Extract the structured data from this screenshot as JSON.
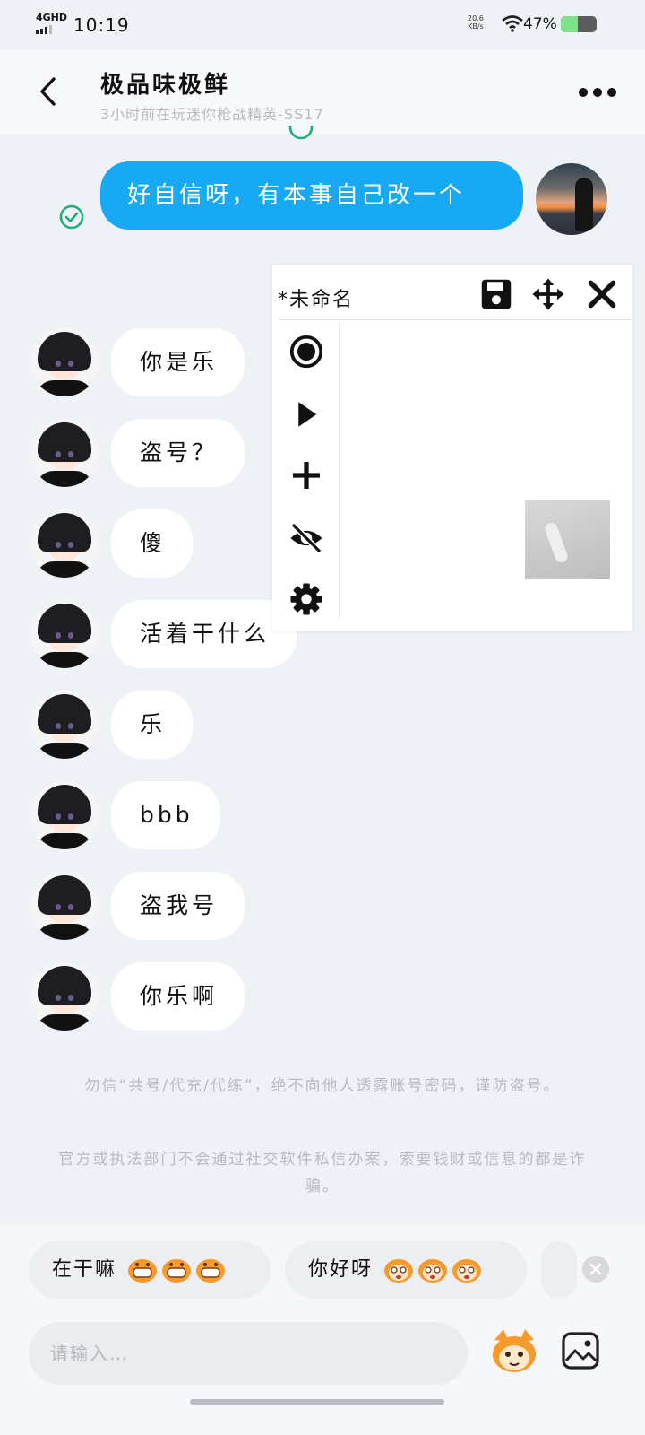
{
  "status_bar": {
    "network": "4GHD",
    "time": "10:19",
    "net_speed_value": "20.6",
    "net_speed_unit": "KB/s",
    "battery_percent": "47%",
    "battery_level": 0.47
  },
  "header": {
    "title": "极品味极鲜",
    "subtitle": "3小时前在玩迷你枪战精英-SS17"
  },
  "messages": {
    "sent": "好自信呀，有本事自己改一个",
    "received": [
      "你是乐",
      "盗号？",
      "傻",
      "活着干什么",
      "乐",
      "bbb",
      "盗我号",
      "你乐啊"
    ]
  },
  "notices": [
    "勿信“共号/代充/代练”，绝不向他人透露账号密码，谨防盗号。",
    "官方或执法部门不会通过社交软件私信办案，索要钱财或信息的都是诈骗。"
  ],
  "tool_panel": {
    "title": "*未命名",
    "icons": [
      "save-icon",
      "move-icon",
      "close-icon",
      "record-icon",
      "play-icon",
      "add-icon",
      "hide-icon",
      "settings-icon"
    ]
  },
  "quick_replies": [
    {
      "label": "在干嘛"
    },
    {
      "label": "你好呀"
    }
  ],
  "input": {
    "placeholder": "请输入…"
  },
  "colors": {
    "sent_bubble": "#18a9f5",
    "received_bubble": "#ffffff",
    "background": "#eef1f6",
    "check_green": "#1fae76",
    "battery_green": "#7ee28a"
  }
}
